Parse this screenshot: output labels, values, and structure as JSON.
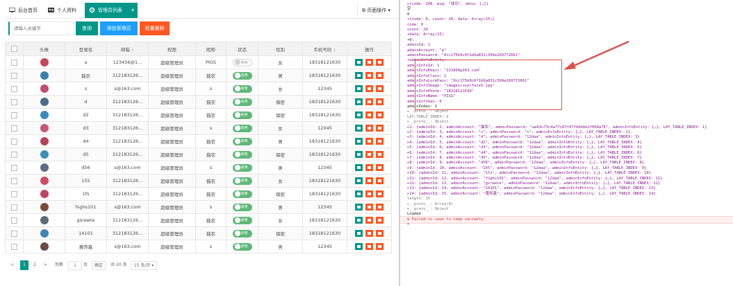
{
  "tabs": [
    {
      "label": "后台首页",
      "icon": "monitor-icon"
    },
    {
      "label": "个人资料",
      "icon": "id-card-icon"
    },
    {
      "label": "管理员列表",
      "icon": "gear-icon",
      "active": true
    }
  ],
  "page_ops": "页面操作",
  "toolbar": {
    "search_placeholder": "请输入关键字",
    "search_btn": "查询",
    "add_btn": "添加管理员",
    "batch_delete_btn": "批量删除"
  },
  "colors": {
    "primary": "#009688",
    "blue": "#1E9FFF",
    "danger": "#FF5722",
    "switch_on": "#5FB878"
  },
  "table": {
    "columns": [
      "头像",
      "登录名",
      "邮箱",
      "权限",
      "昵称",
      "状态",
      "性别",
      "手机号码",
      "操作"
    ],
    "rows": [
      {
        "login": "a",
        "email": "123456@1...",
        "role": "超级管理员",
        "nick": "PIGS",
        "on": false,
        "gender": "女",
        "phone": "18318121630"
      },
      {
        "login": "猫农",
        "email": "312183126...",
        "role": "超级管理员",
        "nick": "猫农",
        "on": true,
        "gender": "男",
        "phone": "18318121630"
      },
      {
        "login": "s",
        "email": "s@163.com",
        "role": "超级管理员",
        "nick": "s",
        "on": true,
        "gender": "女",
        "phone": "12345"
      },
      {
        "login": "d",
        "email": "312183126...",
        "role": "超级管理员",
        "nick": "猫农",
        "on": true,
        "gender": "保密",
        "phone": "18318121630"
      },
      {
        "login": "d2",
        "email": "312183126...",
        "role": "超级管理员",
        "nick": "猫农",
        "on": true,
        "gender": "保密",
        "phone": "18318121630"
      },
      {
        "login": "d3",
        "email": "312183126...",
        "role": "超级管理员",
        "nick": "s",
        "on": true,
        "gender": "女",
        "phone": "12345"
      },
      {
        "login": "d4",
        "email": "312183126...",
        "role": "超级管理员",
        "nick": "猫农",
        "on": true,
        "gender": "男",
        "phone": "18318121630"
      },
      {
        "login": "d5",
        "email": "312183126...",
        "role": "超级管理员",
        "nick": "猫农",
        "on": true,
        "gender": "保密",
        "phone": "18318121630"
      },
      {
        "login": "d56",
        "email": "s@163.com",
        "role": "超级管理员",
        "nick": "s",
        "on": true,
        "gender": "男",
        "phone": "12345"
      },
      {
        "login": "155",
        "email": "312183126...",
        "role": "超级管理员",
        "nick": "猫农",
        "on": true,
        "gender": "女",
        "phone": "18318121630"
      },
      {
        "login": "1fs",
        "email": "312183126...",
        "role": "超级管理员",
        "nick": "猫农",
        "on": true,
        "gender": "保密",
        "phone": "18318121630"
      },
      {
        "login": "fsghs101",
        "email": "s@163.com",
        "role": "超级管理员",
        "nick": "s",
        "on": true,
        "gender": "男",
        "phone": "12345"
      },
      {
        "login": "gsrewte",
        "email": "312183126...",
        "role": "超级管理员",
        "nick": "猫农",
        "on": true,
        "gender": "女",
        "phone": "18318121630"
      },
      {
        "login": "14101",
        "email": "312183126...",
        "role": "超级管理员",
        "nick": "猫农",
        "on": true,
        "gender": "保密",
        "phone": "18318121630"
      },
      {
        "login": "黄传鑫",
        "email": "s@163.com",
        "role": "超级管理员",
        "nick": "s",
        "on": true,
        "gender": "男",
        "phone": "12345"
      }
    ],
    "switch_on_text": "启用",
    "switch_off_text": "禁用"
  },
  "pager": {
    "prev": "<",
    "page1": "1",
    "page2": "2",
    "next": ">",
    "goto_label": "到第",
    "goto_value": "1",
    "page_unit": "页",
    "confirm": "确定",
    "total": "共 20 条",
    "per_page": "15 条/页"
  },
  "console": {
    "lines": [
      "▸{code: 200, msg: \"成功\", data: {…}}",
      "空",
      "0",
      "▾{code: 0, count: 20, data: Array(15)}",
      "    code: 0",
      "    count: 20",
      "  ▾data: Array(15)",
      "    ▾0:",
      "        adminId: 1",
      "        adminAccount: \"a\"",
      "        adminPassword: \"0cc175b9c0f1b6a831c399e269772661\"",
      "      ▾adminInfoEntity:",
      "          adminInfoId: 1",
      "          adminInfoEmail: \"123456@163.com\"",
      "          adminInfoClass: 1",
      "          adminInfoLockPass: \"0cc175b9c0f1b6a831c399e269772661\"",
      "          adminInfoImage: \"images/userface5.jpg\"",
      "          adminInfoPhone: \"18318121630\"",
      "          adminInfoName: \"PIGS\"",
      "          adminInfoSex: 0",
      "          adminIndex: 1",
      "        ▸__proto__: Object",
      "        LAY_TABLE_INDEX: 0",
      "      ▸__proto__: Object",
      "    ▸1: {adminId: 2, adminAccount: \"猫农\", adminPassword: \"aa63c75c4a77c87f97fb6bbb2f068a76\", adminInfoEntity: {…}, LAY_TABLE_INDEX: 1}",
      "    ▸2: {adminId: 3, adminAccount: \"s\", adminPassword: \"s\", adminInfoEntity: {…}, LAY_TABLE_INDEX: 2}",
      "    ▸3: {adminId: 4, adminAccount: \"d\", adminPassword: \"12daa\", adminInfoEntity: {…}, LAY_TABLE_INDEX: 3}",
      "    ▸4: {adminId: 5, adminAccount: \"d2\", adminPassword: \"12daa\", adminInfoEntity: {…}, LAY_TABLE_INDEX: 4}",
      "    ▸5: {adminId: 6, adminAccount: \"d3\", adminPassword: \"12daa\", adminInfoEntity: {…}, LAY_TABLE_INDEX: 5}",
      "    ▸6: {adminId: 7, adminAccount: \"d4\", adminPassword: \"12daa\", adminInfoEntity: {…}, LAY_TABLE_INDEX: 6}",
      "    ▸7: {adminId: 8, adminAccount: \"d5\", adminPassword: \"12daa\", adminInfoEntity: {…}, LAY_TABLE_INDEX: 7}",
      "    ▸8: {adminId: 9, adminAccount: \"d56\", adminPassword: \"12daa\", adminInfoEntity: {…}, LAY_TABLE_INDEX: 8}",
      "    ▸9: {adminId: 10, adminAccount: \"155\", adminPassword: \"12daa\", adminInfoEntity: {…}, LAY_TABLE_INDEX: 9}",
      "    ▸10: {adminId: 11, adminAccount: \"1fs\", adminPassword: \"12daa\", adminInfoEntity: {…}, LAY_TABLE_INDEX: 10}",
      "    ▸11: {adminId: 12, adminAccount: \"fsghs101\", adminPassword: \"12daa\", adminInfoEntity: {…}, LAY_TABLE_INDEX: 11}",
      "    ▸12: {adminId: 13, adminAccount: \"gsrewte\", adminPassword: \"12daa\", adminInfoEntity: {…}, LAY_TABLE_INDEX: 12}",
      "    ▸13: {adminId: 14, adminAccount: \"14101\", adminPassword: \"12daa\", adminInfoEntity: {…}, LAY_TABLE_INDEX: 13}",
      "    ▸14: {adminId: 15, adminAccount: \"黄传鑫\", adminPassword: \"12daa\", adminInfoEntity: {…}, LAY_TABLE_INDEX: 14}",
      "      length: 15",
      "    ▸__proto__: Array(0)",
      "  ▸__proto__: Object",
      "Loaded",
      "⊗ Failed to save to temp variable.",
      ">"
    ]
  }
}
